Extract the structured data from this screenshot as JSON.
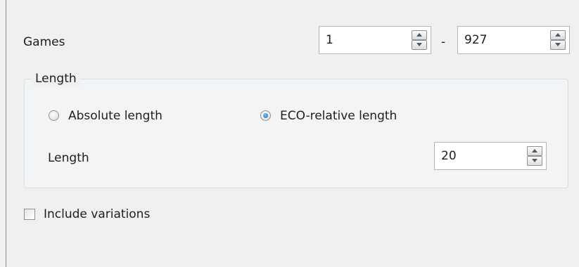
{
  "games": {
    "label": "Games",
    "from_value": "1",
    "separator": "-",
    "to_value": "927"
  },
  "length_group": {
    "title": "Length",
    "radio_absolute_label": "Absolute length",
    "radio_eco_label": "ECO-relative length",
    "selected": "ECO-relative length",
    "length_label": "Length",
    "length_value": "20"
  },
  "variations": {
    "label": "Include variations",
    "checked": false
  },
  "colors": {
    "background": "#f0f0f0",
    "radio_selected": "#1a5ea8"
  }
}
